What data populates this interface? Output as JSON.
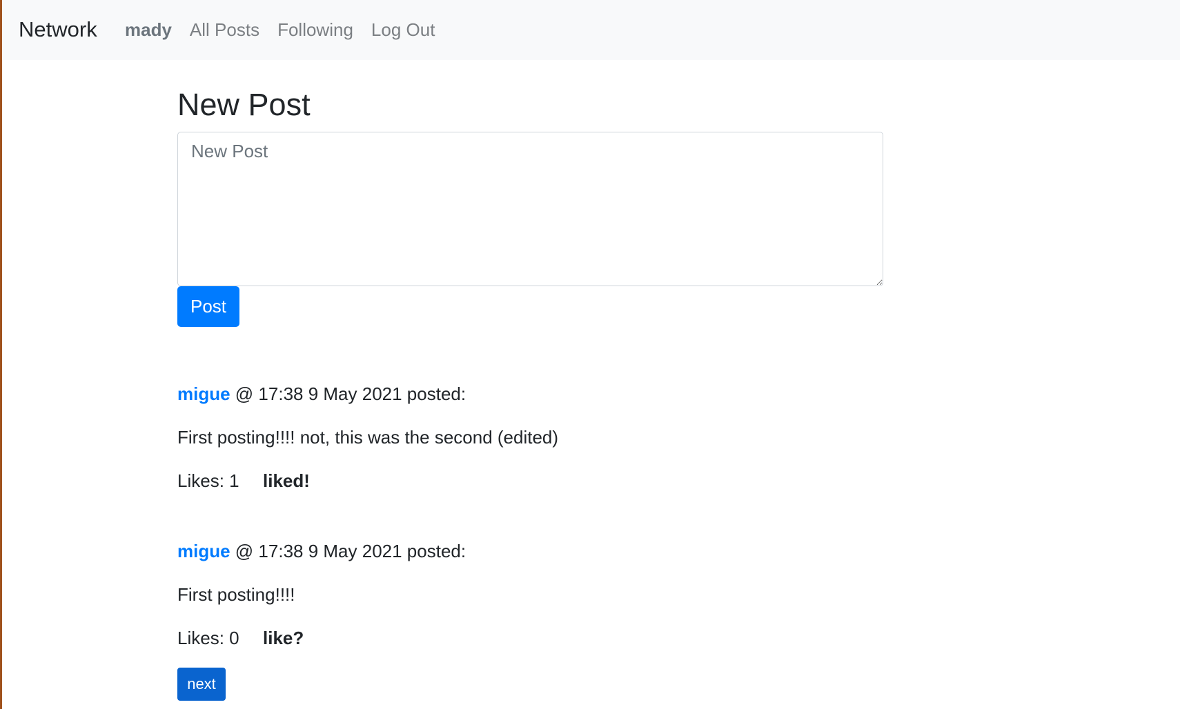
{
  "navbar": {
    "brand": "Network",
    "user": "mady",
    "links": [
      "All Posts",
      "Following",
      "Log Out"
    ]
  },
  "new_post": {
    "title": "New Post",
    "placeholder": "New Post",
    "button_label": "Post"
  },
  "posts": [
    {
      "author": "migue",
      "meta": " @ 17:38 9 May 2021 posted:",
      "body": "First posting!!!! not, this was the second (edited)",
      "likes": "Likes: 1",
      "like_action": "liked!"
    },
    {
      "author": "migue",
      "meta": " @ 17:38 9 May 2021 posted:",
      "body": "First posting!!!!",
      "likes": "Likes: 0",
      "like_action": "like?"
    }
  ],
  "pagination": {
    "next_label": "next"
  },
  "colors": {
    "primary": "#007bff",
    "navbar_bg": "#f8f9fa",
    "next_button": "#0a64cf"
  }
}
